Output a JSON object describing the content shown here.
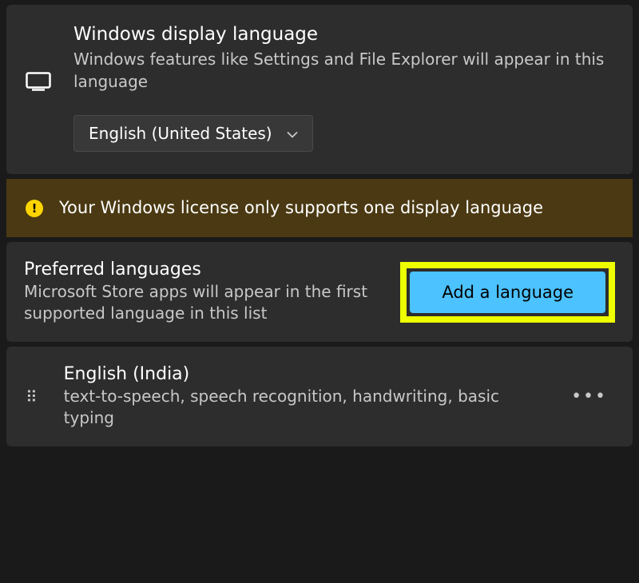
{
  "displayLanguage": {
    "title": "Windows display language",
    "description": "Windows features like Settings and File Explorer will appear in this language",
    "selected": "English (United States)"
  },
  "warning": {
    "text": "Your Windows license only supports one display language"
  },
  "preferred": {
    "title": "Preferred languages",
    "description": "Microsoft Store apps will appear in the first supported language in this list",
    "addButton": "Add a language"
  },
  "languages": [
    {
      "name": "English (India)",
      "features": "text-to-speech, speech recognition, handwriting, basic typing"
    }
  ]
}
